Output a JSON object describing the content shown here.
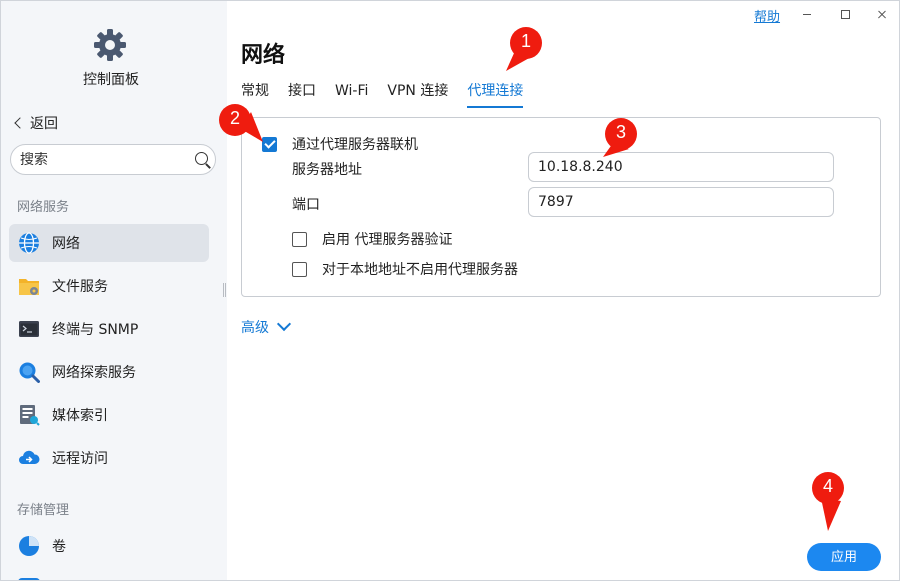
{
  "titlebar": {
    "help_label": "帮助",
    "window_buttons": [
      "minimize-icon",
      "maximize-icon",
      "close-icon"
    ]
  },
  "sidebar": {
    "app_icon": "gear-icon",
    "app_title": "控制面板",
    "back_label": "返回",
    "search_placeholder": "搜索",
    "sections": [
      {
        "label": "网络服务",
        "items": [
          {
            "label": "网络",
            "icon": "globe-icon",
            "active": true
          },
          {
            "label": "文件服务",
            "icon": "folder-icon"
          },
          {
            "label": "终端与 SNMP",
            "icon": "terminal-icon"
          },
          {
            "label": "网络探索服务",
            "icon": "magnifier-icon"
          },
          {
            "label": "媒体索引",
            "icon": "media-index-icon"
          },
          {
            "label": "远程访问",
            "icon": "cloud-icon"
          }
        ]
      },
      {
        "label": "存储管理",
        "items": [
          {
            "label": "卷",
            "icon": "pie-icon"
          }
        ]
      }
    ]
  },
  "main": {
    "title": "网络",
    "tabs": [
      {
        "label": "常规"
      },
      {
        "label": "接口"
      },
      {
        "label": "Wi-Fi"
      },
      {
        "label": "VPN 连接"
      },
      {
        "label": "代理连接",
        "active": true
      }
    ],
    "proxy": {
      "use_proxy_label": "通过代理服务器联机",
      "use_proxy_checked": true,
      "server_label": "服务器地址",
      "server_value": "10.18.8.240",
      "port_label": "端口",
      "port_value": "7897",
      "auth_label": "启用 代理服务器验证",
      "auth_checked": false,
      "bypass_label": "对于本地地址不启用代理服务器",
      "bypass_checked": false
    },
    "advanced_label": "高级",
    "apply_label": "应用"
  },
  "annotations": [
    "1",
    "2",
    "3",
    "4"
  ],
  "colors": {
    "accent": "#1479d4",
    "apply_button": "#1c88f0",
    "annotation_red": "#ef1c0f",
    "sidebar_bg": "#f4f6f9",
    "active_item_bg": "#dfe3e9"
  }
}
